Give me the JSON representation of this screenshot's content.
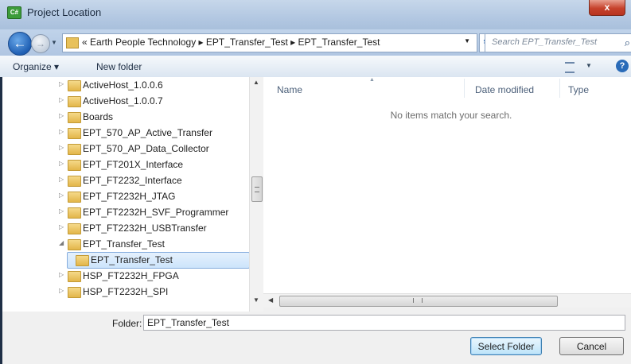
{
  "window": {
    "title": "Project Location",
    "close_label": "x"
  },
  "address": {
    "prefix": "«",
    "breadcrumb": [
      "Earth People Technology",
      "EPT_Transfer_Test",
      "EPT_Transfer_Test"
    ],
    "breadcrumb_text": "« Earth People Technology ▸ EPT_Transfer_Test ▸ EPT_Transfer_Test",
    "search_placeholder": "Search EPT_Transfer_Test"
  },
  "toolbar": {
    "organize_label": "Organize ▾",
    "new_folder_label": "New folder"
  },
  "nav_tree": [
    {
      "label": "ActiveHost_1.0.0.6",
      "expander": "▷",
      "indent": 0
    },
    {
      "label": "ActiveHost_1.0.0.7",
      "expander": "▷",
      "indent": 0
    },
    {
      "label": "Boards",
      "expander": "▷",
      "indent": 0
    },
    {
      "label": "EPT_570_AP_Active_Transfer",
      "expander": "▷",
      "indent": 0
    },
    {
      "label": "EPT_570_AP_Data_Collector",
      "expander": "▷",
      "indent": 0
    },
    {
      "label": "EPT_FT201X_Interface",
      "expander": "▷",
      "indent": 0
    },
    {
      "label": "EPT_FT2232_Interface",
      "expander": "▷",
      "indent": 0
    },
    {
      "label": "EPT_FT2232H_JTAG",
      "expander": "▷",
      "indent": 0
    },
    {
      "label": "EPT_FT2232H_SVF_Programmer",
      "expander": "▷",
      "indent": 0
    },
    {
      "label": "EPT_FT2232H_USBTransfer",
      "expander": "▷",
      "indent": 0
    },
    {
      "label": "EPT_Transfer_Test",
      "expander": "◢",
      "indent": 0
    },
    {
      "label": "EPT_Transfer_Test",
      "expander": "",
      "indent": 1,
      "selected": true
    },
    {
      "label": "HSP_FT2232H_FPGA",
      "expander": "▷",
      "indent": 0
    },
    {
      "label": "HSP_FT2232H_SPI",
      "expander": "▷",
      "indent": 0
    }
  ],
  "content": {
    "columns": [
      "Name",
      "Date modified",
      "Type"
    ],
    "empty_message": "No items match your search."
  },
  "footer": {
    "folder_label": "Folder:",
    "folder_value": "EPT_Transfer_Test",
    "select_label": "Select Folder",
    "cancel_label": "Cancel"
  }
}
